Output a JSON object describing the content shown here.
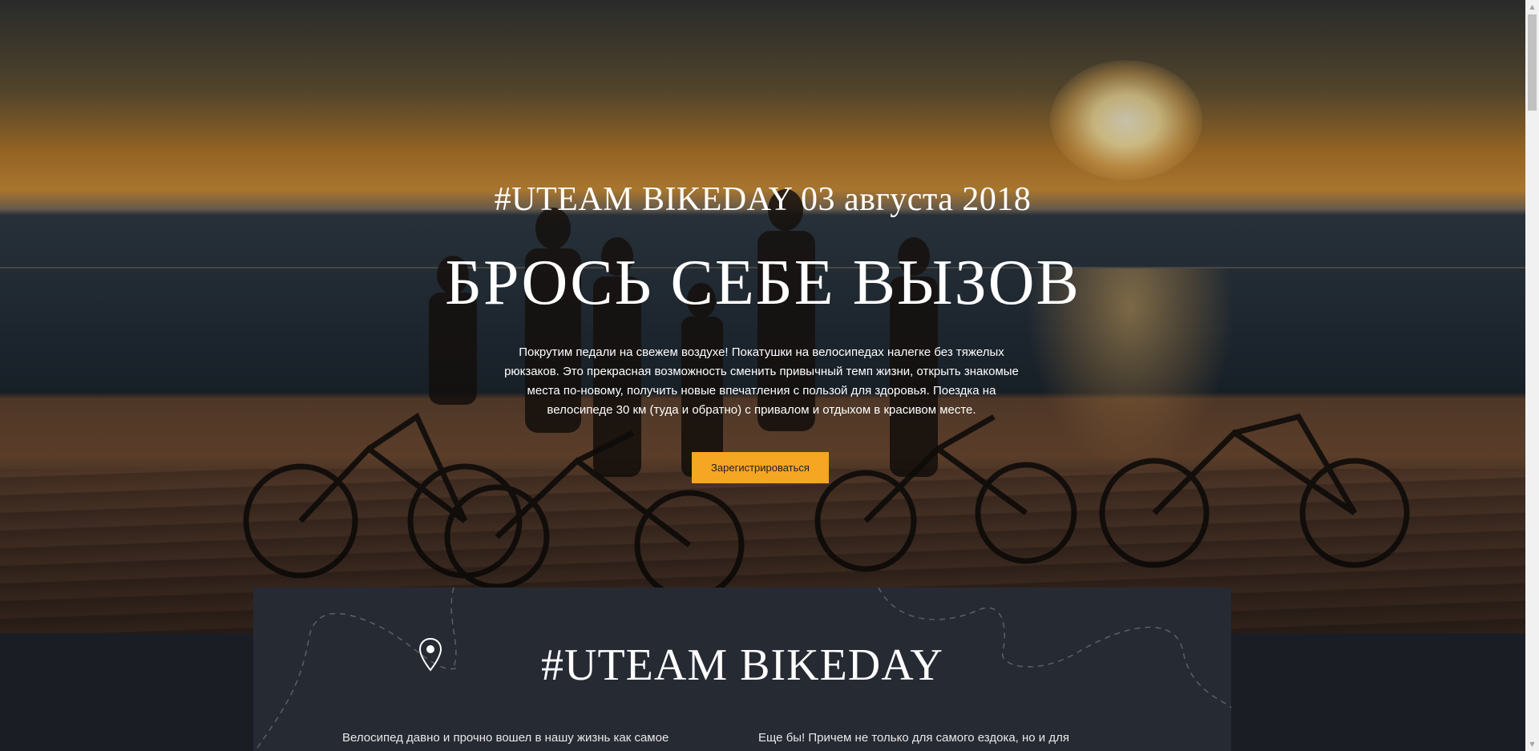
{
  "hero": {
    "date_heading": "#UTEAM BIKEDAY 03 августа 2018",
    "title": "БРОСЬ СЕБЕ ВЫЗОВ",
    "description": "Покрутим педали на свежем воздухе! Покатушки на велосипедах налегке без тяжелых рюкзаков. Это прекрасная возможность сменить привычный темп жизни, открыть знакомые места по-новому, получить новые впечатления с пользой для здоровья. Поездка на велосипеде 30 км (туда и обратно) с привалом и отдыхом в красивом месте.",
    "register_label": "Зарегистрироваться",
    "background_image": "sunset-cyclists-photo"
  },
  "info": {
    "title": "#UTEAM BIKEDAY",
    "icon": "map-pin-icon",
    "left_text": "Велосипед давно и прочно вошел в нашу жизнь как самое",
    "right_text": "Еще бы! Причем не только для самого ездока, но и для"
  },
  "colors": {
    "accent": "#f5a623",
    "panel": "#262a33",
    "page_bg": "#1b1d24"
  },
  "scrollbar": {
    "up_arrow": "▲",
    "down_arrow": "▼"
  }
}
